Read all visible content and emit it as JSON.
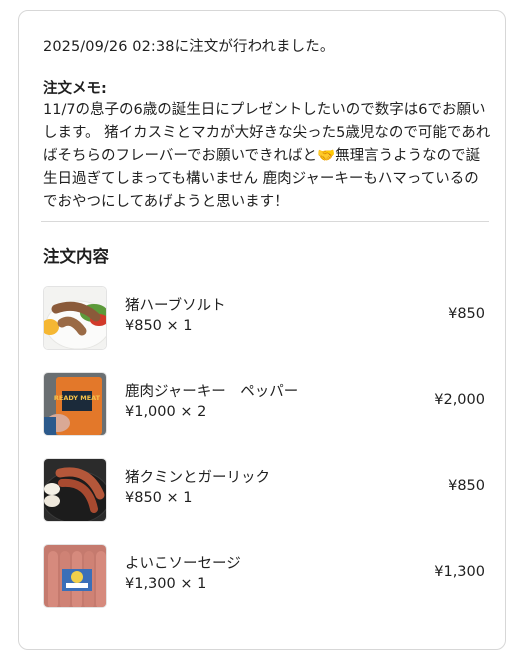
{
  "order": {
    "timestamp_line": "2025/09/26 02:38に注文が行われました。",
    "memo_title": "注文メモ:",
    "memo_text": "11/7の息子の6歳の誕生日にプレゼントしたいので数字は6でお願いします。 猪イカスミとマカが大好きな尖った5歳児なので可能であればそちらのフレーバーでお願いできればと🤝無理言うようなので誕生日過ぎてしまっても構いません 鹿肉ジャーキーもハマっているのでおやつにしてあげようと思います！"
  },
  "contents": {
    "title": "注文内容",
    "items": [
      {
        "name": "猪ハーブソルト",
        "qty": "¥850 × 1",
        "price": "¥850",
        "image": "sausage-plate-image"
      },
      {
        "name": "鹿肉ジャーキー　ペッパー",
        "qty": "¥1,000 × 2",
        "price": "¥2,000",
        "image": "ready-meat-package-image",
        "image_text": "READY MEAT"
      },
      {
        "name": "猪クミンとガーリック",
        "qty": "¥850 × 1",
        "price": "¥850",
        "image": "grilled-sausage-pan-image"
      },
      {
        "name": "よいこソーセージ",
        "qty": "¥1,300 × 1",
        "price": "¥1,300",
        "image": "kids-sausage-package-image"
      }
    ]
  }
}
